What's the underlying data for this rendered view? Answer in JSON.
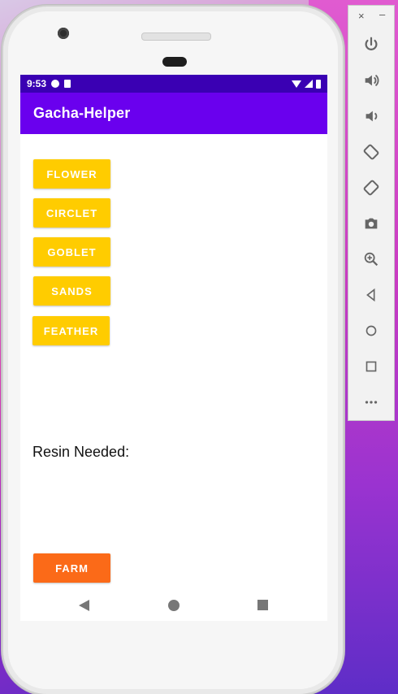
{
  "status_bar": {
    "time": "9:53"
  },
  "app_bar": {
    "title": "Gacha-Helper"
  },
  "buttons": {
    "flower": "FLOWER",
    "circlet": "CIRCLET",
    "goblet": "GOBLET",
    "sands": "SANDS",
    "feather": "FEATHER",
    "farm": "FARM"
  },
  "resin_label": "Resin Needed:",
  "colors": {
    "status_bar": "#3a00b3",
    "app_bar": "#6a00ee",
    "artifact_button": "#ffcc00",
    "farm_button": "#fb6a18"
  },
  "emulator_panel": {
    "window_close": "×",
    "window_minimize": "–",
    "controls": [
      "power-icon",
      "volume-up-icon",
      "volume-down-icon",
      "rotate-left-icon",
      "rotate-right-icon",
      "camera-icon",
      "zoom-icon",
      "back-icon",
      "home-icon",
      "overview-icon",
      "more-icon"
    ]
  }
}
